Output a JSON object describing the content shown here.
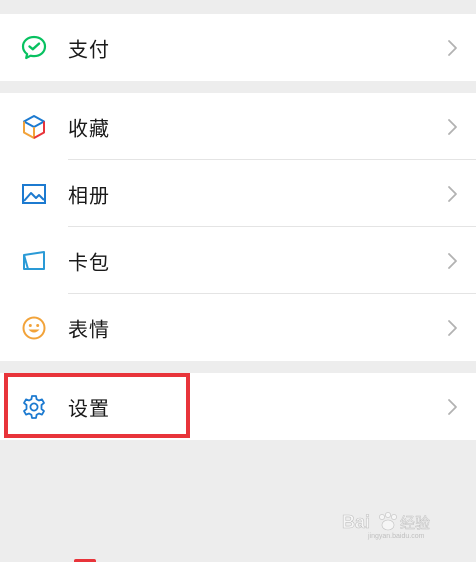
{
  "menu": {
    "pay": {
      "label": "支付",
      "icon": "wechat-pay-icon"
    },
    "favorites": {
      "label": "收藏",
      "icon": "favorites-cube-icon"
    },
    "album": {
      "label": "相册",
      "icon": "album-image-icon"
    },
    "cards": {
      "label": "卡包",
      "icon": "card-wallet-icon"
    },
    "stickers": {
      "label": "表情",
      "icon": "emoji-smile-icon"
    },
    "settings": {
      "label": "设置",
      "icon": "gear-icon"
    }
  },
  "colors": {
    "background": "#ededed",
    "row": "#ffffff",
    "pay_green": "#07c160",
    "highlight_red": "#e8343a",
    "album_blue": "#1c7ad0",
    "stickers_orange": "#f2a33a"
  },
  "watermark": {
    "text": "Bai 经验",
    "url_text": "jingyan.baidu.com"
  }
}
